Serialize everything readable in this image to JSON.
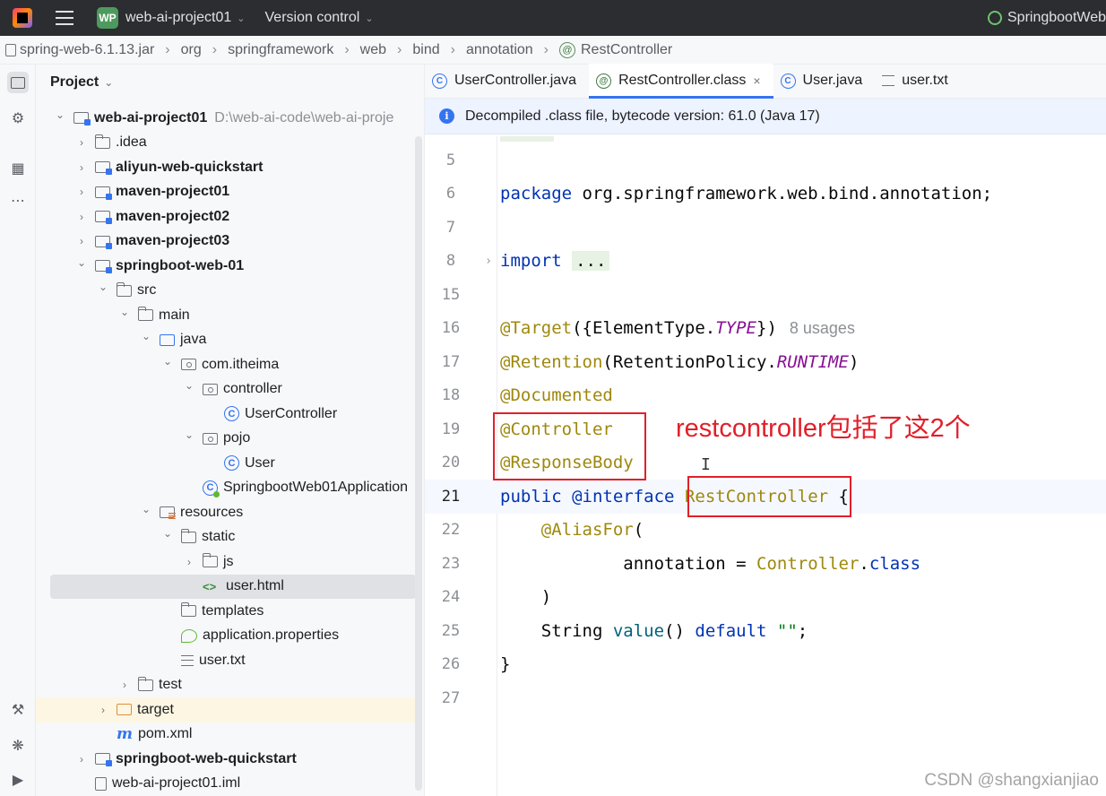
{
  "titlebar": {
    "project_badge": "WP",
    "project_name": "web-ai-project01",
    "vcs_label": "Version control",
    "run_config": "SpringbootWeb"
  },
  "breadcrumb": [
    "spring-web-6.1.13.jar",
    "org",
    "springframework",
    "web",
    "bind",
    "annotation",
    "RestController"
  ],
  "project_panel": {
    "title": "Project",
    "tree": [
      {
        "label": "web-ai-project01",
        "path": "D:\\web-ai-code\\web-ai-proje",
        "bold": true,
        "arrow": "down",
        "icon": "module",
        "indent": 0
      },
      {
        "label": ".idea",
        "arrow": "right",
        "icon": "folder",
        "indent": 1
      },
      {
        "label": "aliyun-web-quickstart",
        "bold": true,
        "arrow": "right",
        "icon": "module",
        "indent": 1
      },
      {
        "label": "maven-project01",
        "bold": true,
        "arrow": "right",
        "icon": "module",
        "indent": 1
      },
      {
        "label": "maven-project02",
        "bold": true,
        "arrow": "right",
        "icon": "module",
        "indent": 1
      },
      {
        "label": "maven-project03",
        "bold": true,
        "arrow": "right",
        "icon": "module",
        "indent": 1
      },
      {
        "label": "springboot-web-01",
        "bold": true,
        "arrow": "down",
        "icon": "module",
        "indent": 1
      },
      {
        "label": "src",
        "arrow": "down",
        "icon": "folder",
        "indent": 2
      },
      {
        "label": "main",
        "arrow": "down",
        "icon": "folder",
        "indent": 3
      },
      {
        "label": "java",
        "arrow": "down",
        "icon": "srcfolder",
        "indent": 4
      },
      {
        "label": "com.itheima",
        "arrow": "down",
        "icon": "pkg",
        "indent": 5
      },
      {
        "label": "controller",
        "arrow": "down",
        "icon": "pkg",
        "indent": 6
      },
      {
        "label": "UserController",
        "arrow": "none",
        "icon": "cls",
        "indent": 7
      },
      {
        "label": "pojo",
        "arrow": "down",
        "icon": "pkg",
        "indent": 6
      },
      {
        "label": "User",
        "arrow": "none",
        "icon": "cls",
        "indent": 7
      },
      {
        "label": "SpringbootWeb01Application",
        "arrow": "none",
        "icon": "springcls",
        "indent": 6
      },
      {
        "label": "resources",
        "arrow": "down",
        "icon": "resfolder",
        "indent": 4
      },
      {
        "label": "static",
        "arrow": "down",
        "icon": "folder",
        "indent": 5
      },
      {
        "label": "js",
        "arrow": "right",
        "icon": "folder",
        "indent": 6
      },
      {
        "label": "user.html",
        "arrow": "none",
        "icon": "html",
        "indent": 6,
        "selected": true
      },
      {
        "label": "templates",
        "arrow": "none",
        "icon": "folder",
        "indent": 5
      },
      {
        "label": "application.properties",
        "arrow": "none",
        "icon": "props",
        "indent": 5
      },
      {
        "label": "user.txt",
        "arrow": "none",
        "icon": "txt",
        "indent": 5
      },
      {
        "label": "test",
        "arrow": "right",
        "icon": "folder",
        "indent": 3
      },
      {
        "label": "target",
        "arrow": "right",
        "icon": "orangefolder",
        "indent": 2,
        "highlight": true
      },
      {
        "label": "pom.xml",
        "arrow": "none",
        "icon": "maven",
        "indent": 2
      },
      {
        "label": "springboot-web-quickstart",
        "bold": true,
        "arrow": "right",
        "icon": "module",
        "indent": 1
      },
      {
        "label": "web-ai-project01.iml",
        "arrow": "none",
        "icon": "iml",
        "indent": 1
      }
    ]
  },
  "editor": {
    "tabs": [
      {
        "label": "UserController.java",
        "icon": "C",
        "active": false
      },
      {
        "label": "RestController.class",
        "icon": "@",
        "active": true,
        "closable": true
      },
      {
        "label": "User.java",
        "icon": "C",
        "active": false
      },
      {
        "label": "user.txt",
        "icon": "txt",
        "active": false
      }
    ],
    "banner": "Decompiled .class file, bytecode version: 61.0 (Java 17)",
    "lines": {
      "l5": "5",
      "l6": "6",
      "l7": "7",
      "l8": "8",
      "l15": "15",
      "l16": "16",
      "l17": "17",
      "l18": "18",
      "l19": "19",
      "l20": "20",
      "l21": "21",
      "l22": "22",
      "l23": "23",
      "l24": "24",
      "l25": "25",
      "l26": "26",
      "l27": "27"
    },
    "code": {
      "package_kw": "package",
      "package_name": " org.springframework.web.bind.annotation;",
      "import_kw": "import",
      "import_folded": "...",
      "target_ann": "@Target",
      "target_open": "({ElementType.",
      "target_const": "TYPE",
      "target_close": "})",
      "usages_hint": "8 usages",
      "retention_ann": "@Retention",
      "retention_open": "(RetentionPolicy.",
      "retention_const": "RUNTIME",
      "retention_close": ")",
      "documented_ann": "@Documented",
      "controller_ann": "@Controller",
      "responsebody_ann": "@ResponseBody",
      "public_kw": "public",
      "interface_kw": "@interface",
      "type_name": "RestController",
      "open_brace": " {",
      "aliasfor_ann": "@AliasFor",
      "aliasfor_open": "(",
      "annotation_attr": "annotation = ",
      "controller_ref": "Controller",
      "dot": ".",
      "class_kw": "class",
      "close_paren": ")",
      "string_type": "String ",
      "value_method": "value",
      "value_parens": "() ",
      "default_kw": "default",
      "empty_string": " \"\"",
      "semicolon": ";",
      "close_brace": "}"
    }
  },
  "annotation_note": "restcontroller包括了这2个",
  "watermark": "CSDN @shangxianjiao"
}
